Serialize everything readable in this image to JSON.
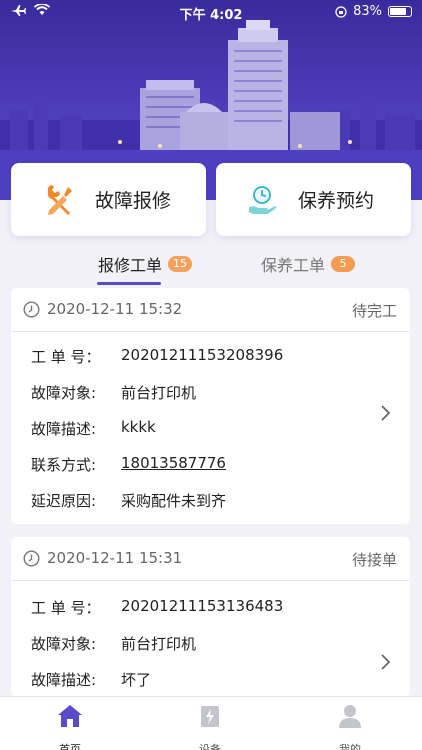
{
  "status_bar": {
    "time": "下午 4:02",
    "battery": "83%"
  },
  "actions": {
    "repair": {
      "label": "故障报修",
      "icon": "wrench-screwdriver-icon"
    },
    "maintenance": {
      "label": "保养预约",
      "icon": "clock-hand-icon"
    }
  },
  "tabs": [
    {
      "label": "报修工单",
      "count": "15",
      "active": true
    },
    {
      "label": "保养工单",
      "count": "5",
      "active": false
    }
  ],
  "orders": [
    {
      "datetime": "2020-12-11 15:32",
      "status": "待完工",
      "fields": [
        {
          "key": "工 单 号：",
          "value": "20201211153208396"
        },
        {
          "key": "故障对象:",
          "value": "前台打印机"
        },
        {
          "key": "故障描述:",
          "value": "kkkk"
        },
        {
          "key": "联系方式:",
          "value": "18013587776"
        },
        {
          "key": "延迟原因:",
          "value": "采购配件未到齐"
        }
      ]
    },
    {
      "datetime": "2020-12-11 15:31",
      "status": "待接单",
      "fields": [
        {
          "key": "工 单 号：",
          "value": "20201211153136483"
        },
        {
          "key": "故障对象:",
          "value": "前台打印机"
        },
        {
          "key": "故障描述:",
          "value": "坏了"
        }
      ]
    }
  ],
  "bottom_nav": [
    {
      "label": "首页",
      "icon": "home-icon",
      "active": true
    },
    {
      "label": "设备",
      "icon": "device-icon",
      "active": false
    },
    {
      "label": "我的",
      "icon": "user-icon",
      "active": false
    }
  ],
  "colors": {
    "accent": "#5a4bc9",
    "badge": "#f4a25b",
    "repair_icon": "#f08a2a",
    "maint_icon": "#3fb9c8"
  }
}
